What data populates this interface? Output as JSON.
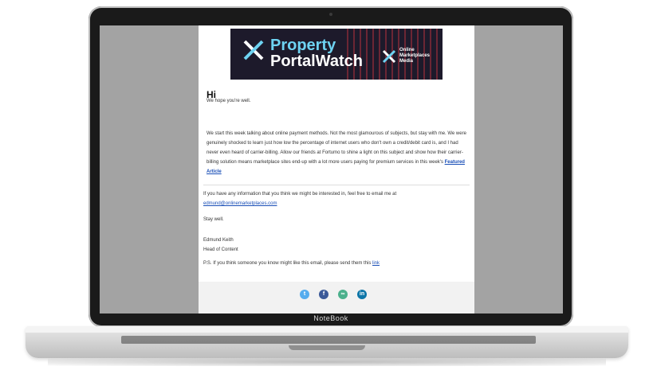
{
  "device": {
    "label": "NoteBook"
  },
  "email": {
    "banner": {
      "title_line1": "Property",
      "title_line2": "PortalWatch",
      "partner": [
        "Online",
        "Marketplaces",
        "Media"
      ]
    },
    "greeting": "Hi",
    "intro": "We hope you're well.",
    "paragraph": "We start this week talking about online payment methods. Not the most glamourous of subjects, but stay with me. We were genuinely shocked to learn just how low the percentage of internet users who don't own a credit/debit card is, and I had never even heard of carrier-billing. Allow our friends at Fortumo to shine a light on this subject and show how their carrier-billing solution means marketplace sites end-up with a lot more users paying for premium services in this week's",
    "featured_link": "Featured Article",
    "info": "If you have any information that you think we might be interested in, feel free to email me at",
    "email_address": "edmund@onlinemarketplaces.com",
    "stay_well": "Stay well.",
    "signature_name": "Edmund Keith",
    "signature_title": "Head of Content",
    "ps": "P.S. If you think someone you know might like this email, please send them this",
    "ps_link": "link",
    "social": {
      "twitter_color": "#55acee",
      "facebook_color": "#3b5998",
      "link_color": "#4bb08c",
      "linkedin_color": "#0e76a8"
    }
  }
}
